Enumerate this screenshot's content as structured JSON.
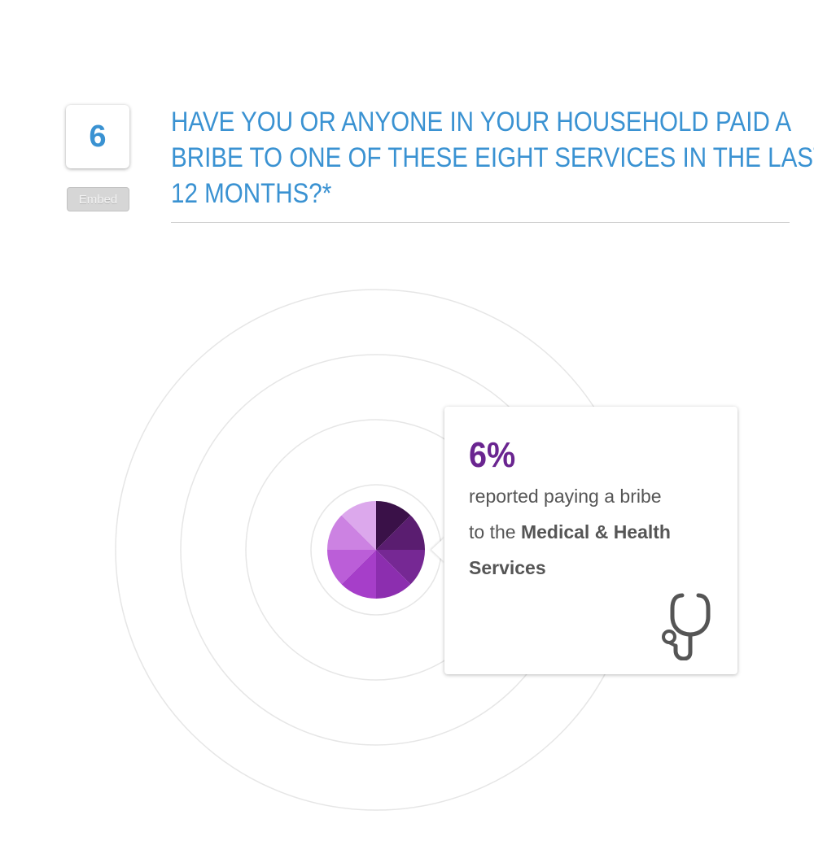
{
  "question": {
    "number": "6",
    "embed_label": "Embed",
    "title_lines": [
      "HAVE YOU OR ANYONE IN YOUR HOUSEHOLD PAID A",
      "BRIBE TO ONE OF THESE EIGHT SERVICES IN THE LAST",
      "12 MONTHS?*"
    ]
  },
  "chart_data": {
    "type": "pie",
    "categories": [
      "",
      "",
      "",
      "",
      "",
      "",
      "",
      ""
    ],
    "values": [
      1,
      1,
      1,
      1,
      1,
      1,
      1,
      1
    ],
    "segment_colors": [
      "#3a1148",
      "#5a1d70",
      "#762894",
      "#8c2eaf",
      "#a63ec9",
      "#bb5ed8",
      "#cc82e2",
      "#dca8ec"
    ],
    "highlighted_service": "Medical & Health Services",
    "highlighted_value": "6%"
  },
  "callout": {
    "percent": "6%",
    "text_prefix": "reported paying a bribe",
    "text_to_the": "to the ",
    "service_name_part1": "Medical & Health",
    "service_name_part2": "Services",
    "icon": "stethoscope-icon"
  },
  "colors": {
    "title_blue": "#3a92d2",
    "percent_purple": "#6a2590",
    "ring_gray": "#e6e6e6"
  }
}
